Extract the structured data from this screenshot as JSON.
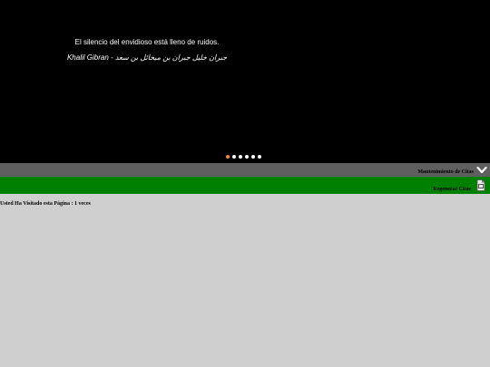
{
  "slider": {
    "quote": "El silencio del envidioso está lleno de ruidos.",
    "author": "Khalil Gibran - جبران خليل جبران بن ميخائل بن سعد",
    "dots_total": 6,
    "active_dot_index": 0
  },
  "toolbar": {
    "mantenimiento_label": "Mantenimiento de Citas",
    "regenerar_label": "Regenerar Citas",
    "expand_icon": "chevron-down-icon",
    "regenerar_icon": "pdf-file-icon"
  },
  "footer": {
    "visits_text": "Usted Ha Visitado esta Página : 1 veces"
  },
  "colors": {
    "slider_bg": "#000000",
    "active_dot": "#f28c28",
    "gray_bar": "#5f5f5f",
    "green_bar": "#008000",
    "page_bg": "#cfcfcf"
  }
}
